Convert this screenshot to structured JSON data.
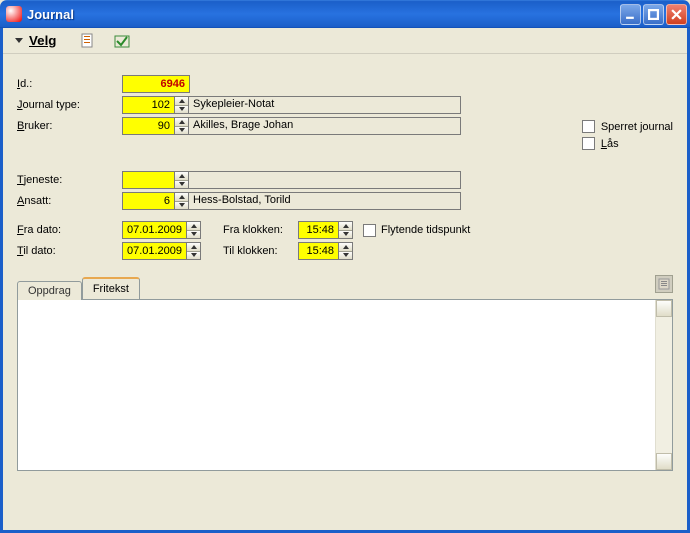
{
  "window": {
    "title": "Journal"
  },
  "toolbar": {
    "velg": "Velg"
  },
  "labels": {
    "id": "Id.:",
    "journal_type": "Journal type:",
    "bruker": "Bruker:",
    "tjeneste": "Tjeneste:",
    "ansatt": "Ansatt:",
    "fra_dato": "Fra dato:",
    "til_dato": "Til dato:",
    "fra_klokken": "Fra klokken:",
    "til_klokken": "Til klokken:"
  },
  "values": {
    "id": "6946",
    "journal_type_code": "102",
    "journal_type_text": "Sykepleier-Notat",
    "bruker_code": "90",
    "bruker_text": "Akilles, Brage Johan",
    "tjeneste_code": "",
    "tjeneste_text": "",
    "ansatt_code": "6",
    "ansatt_text": "Hess-Bolstad, Torild",
    "fra_dato": "07.01.2009",
    "til_dato": "07.01.2009",
    "fra_klokken": "15:48",
    "til_klokken": "15:48"
  },
  "checks": {
    "flytende": "Flytende tidspunkt",
    "sperret": "Sperret journal",
    "las": "Lås"
  },
  "tabs": {
    "oppdrag": "Oppdrag",
    "fritekst": "Fritekst"
  }
}
